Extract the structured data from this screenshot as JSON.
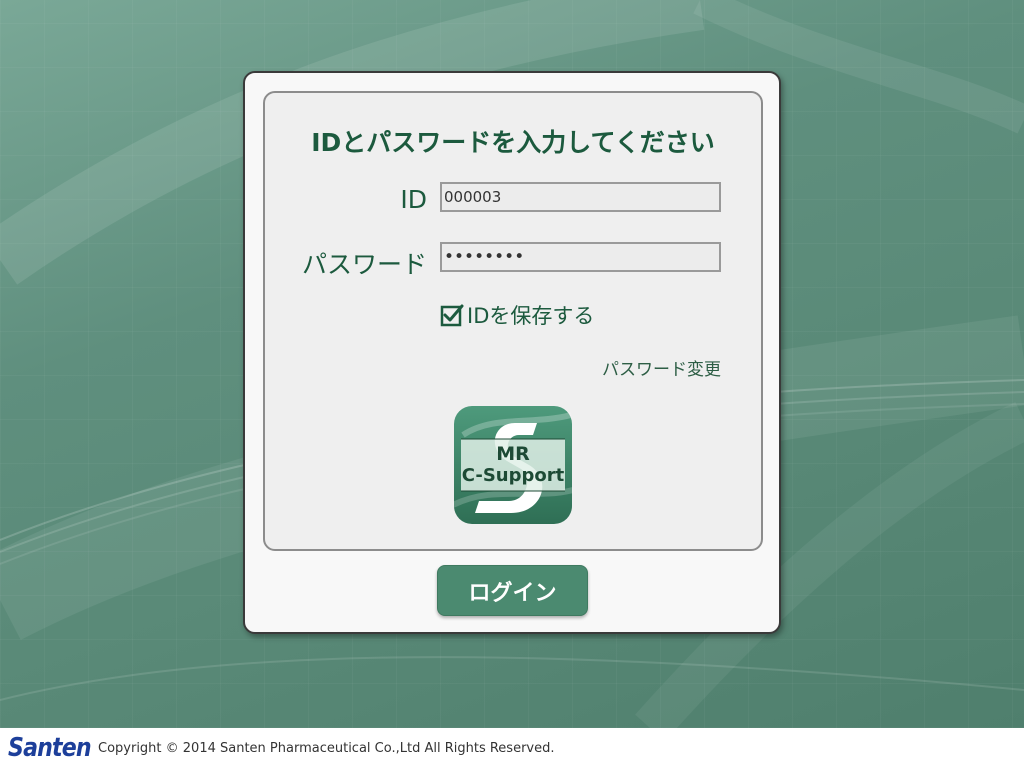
{
  "login_form": {
    "title": "IDとパスワードを入力してください",
    "id_label": "ID",
    "id_value": "000003",
    "password_label": "パスワード",
    "password_value": "********",
    "remember_label": "IDを保存する",
    "remember_checked": true,
    "change_password_link": "パスワード変更",
    "login_button": "ログイン"
  },
  "app_logo": {
    "line1": "MR",
    "line2": "C-Support"
  },
  "footer": {
    "brand": "Santen",
    "copyright": "Copyright © 2014 Santen Pharmaceutical Co.,Ltd All Rights Reserved."
  },
  "colors": {
    "background": "#5a8a78",
    "accent_green": "#1c5a3e",
    "button_green": "#4b8a70",
    "brand_blue": "#1d3f9a"
  }
}
